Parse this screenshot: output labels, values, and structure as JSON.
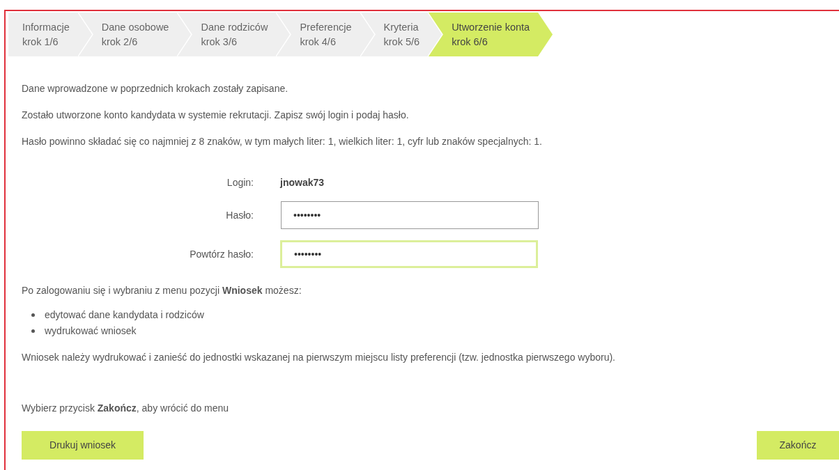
{
  "steps": [
    {
      "title": "Informacje",
      "subtitle": "krok 1/6",
      "selected": false
    },
    {
      "title": "Dane osobowe",
      "subtitle": "krok 2/6",
      "selected": false
    },
    {
      "title": "Dane rodziców",
      "subtitle": "krok 3/6",
      "selected": false
    },
    {
      "title": "Preferencje",
      "subtitle": "krok 4/6",
      "selected": false
    },
    {
      "title": "Kryteria",
      "subtitle": "krok 5/6",
      "selected": false
    },
    {
      "title": "Utworzenie konta",
      "subtitle": "krok 6/6",
      "selected": true
    }
  ],
  "intro": [
    "Dane wprowadzone w poprzednich krokach zostały zapisane.",
    "Zostało utworzone konto kandydata w systemie rekrutacji. Zapisz swój login i podaj hasło.",
    "Hasło powinno składać się co najmniej z 8 znaków, w tym małych liter: 1, wielkich liter: 1, cyfr lub znaków specjalnych: 1."
  ],
  "form": [
    {
      "kind": "static",
      "label": "Login:",
      "value": "jnowak73"
    },
    {
      "kind": "input",
      "label": "Hasło:",
      "value": "••••••••",
      "focused": false
    },
    {
      "kind": "input",
      "label": "Powtórz hasło:",
      "value": "••••••••",
      "focused": true
    }
  ],
  "after_login": "Po zalogowaniu się i wybraniu z menu pozycji **Wniosek** możesz:",
  "actions": [
    "edytować dane kandydata i rodziców",
    "wydrukować wniosek"
  ],
  "note": "Wniosek należy wydrukować i zanieść do jednostki wskazanej na pierwszym miejscu listy preferencji (tzw. jednostka pierwszego wyboru).",
  "finish_hint": "Wybierz przycisk **Zakończ**, aby wrócić do menu",
  "buttons": {
    "print": "Drukuj wniosek",
    "finish": "Zakończ"
  }
}
